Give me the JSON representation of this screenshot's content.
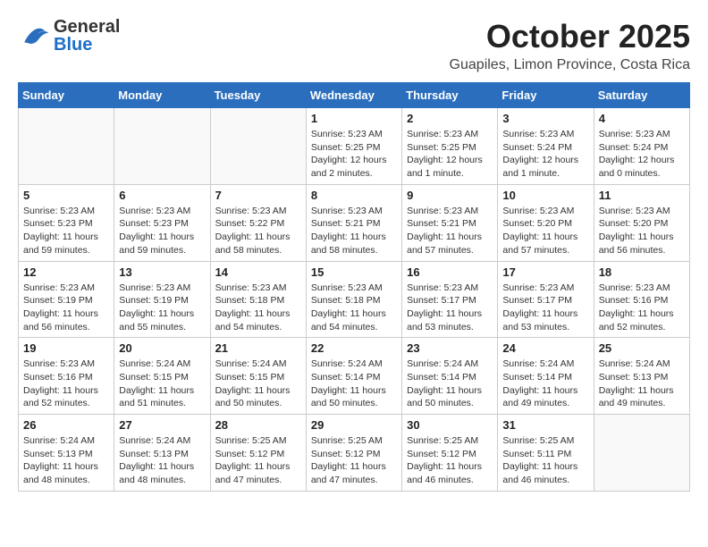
{
  "header": {
    "logo_general": "General",
    "logo_blue": "Blue",
    "month": "October 2025",
    "location": "Guapiles, Limon Province, Costa Rica"
  },
  "weekdays": [
    "Sunday",
    "Monday",
    "Tuesday",
    "Wednesday",
    "Thursday",
    "Friday",
    "Saturday"
  ],
  "weeks": [
    [
      {
        "day": "",
        "info": ""
      },
      {
        "day": "",
        "info": ""
      },
      {
        "day": "",
        "info": ""
      },
      {
        "day": "1",
        "info": "Sunrise: 5:23 AM\nSunset: 5:25 PM\nDaylight: 12 hours and 2 minutes."
      },
      {
        "day": "2",
        "info": "Sunrise: 5:23 AM\nSunset: 5:25 PM\nDaylight: 12 hours and 1 minute."
      },
      {
        "day": "3",
        "info": "Sunrise: 5:23 AM\nSunset: 5:24 PM\nDaylight: 12 hours and 1 minute."
      },
      {
        "day": "4",
        "info": "Sunrise: 5:23 AM\nSunset: 5:24 PM\nDaylight: 12 hours and 0 minutes."
      }
    ],
    [
      {
        "day": "5",
        "info": "Sunrise: 5:23 AM\nSunset: 5:23 PM\nDaylight: 11 hours and 59 minutes."
      },
      {
        "day": "6",
        "info": "Sunrise: 5:23 AM\nSunset: 5:23 PM\nDaylight: 11 hours and 59 minutes."
      },
      {
        "day": "7",
        "info": "Sunrise: 5:23 AM\nSunset: 5:22 PM\nDaylight: 11 hours and 58 minutes."
      },
      {
        "day": "8",
        "info": "Sunrise: 5:23 AM\nSunset: 5:21 PM\nDaylight: 11 hours and 58 minutes."
      },
      {
        "day": "9",
        "info": "Sunrise: 5:23 AM\nSunset: 5:21 PM\nDaylight: 11 hours and 57 minutes."
      },
      {
        "day": "10",
        "info": "Sunrise: 5:23 AM\nSunset: 5:20 PM\nDaylight: 11 hours and 57 minutes."
      },
      {
        "day": "11",
        "info": "Sunrise: 5:23 AM\nSunset: 5:20 PM\nDaylight: 11 hours and 56 minutes."
      }
    ],
    [
      {
        "day": "12",
        "info": "Sunrise: 5:23 AM\nSunset: 5:19 PM\nDaylight: 11 hours and 56 minutes."
      },
      {
        "day": "13",
        "info": "Sunrise: 5:23 AM\nSunset: 5:19 PM\nDaylight: 11 hours and 55 minutes."
      },
      {
        "day": "14",
        "info": "Sunrise: 5:23 AM\nSunset: 5:18 PM\nDaylight: 11 hours and 54 minutes."
      },
      {
        "day": "15",
        "info": "Sunrise: 5:23 AM\nSunset: 5:18 PM\nDaylight: 11 hours and 54 minutes."
      },
      {
        "day": "16",
        "info": "Sunrise: 5:23 AM\nSunset: 5:17 PM\nDaylight: 11 hours and 53 minutes."
      },
      {
        "day": "17",
        "info": "Sunrise: 5:23 AM\nSunset: 5:17 PM\nDaylight: 11 hours and 53 minutes."
      },
      {
        "day": "18",
        "info": "Sunrise: 5:23 AM\nSunset: 5:16 PM\nDaylight: 11 hours and 52 minutes."
      }
    ],
    [
      {
        "day": "19",
        "info": "Sunrise: 5:23 AM\nSunset: 5:16 PM\nDaylight: 11 hours and 52 minutes."
      },
      {
        "day": "20",
        "info": "Sunrise: 5:24 AM\nSunset: 5:15 PM\nDaylight: 11 hours and 51 minutes."
      },
      {
        "day": "21",
        "info": "Sunrise: 5:24 AM\nSunset: 5:15 PM\nDaylight: 11 hours and 50 minutes."
      },
      {
        "day": "22",
        "info": "Sunrise: 5:24 AM\nSunset: 5:14 PM\nDaylight: 11 hours and 50 minutes."
      },
      {
        "day": "23",
        "info": "Sunrise: 5:24 AM\nSunset: 5:14 PM\nDaylight: 11 hours and 50 minutes."
      },
      {
        "day": "24",
        "info": "Sunrise: 5:24 AM\nSunset: 5:14 PM\nDaylight: 11 hours and 49 minutes."
      },
      {
        "day": "25",
        "info": "Sunrise: 5:24 AM\nSunset: 5:13 PM\nDaylight: 11 hours and 49 minutes."
      }
    ],
    [
      {
        "day": "26",
        "info": "Sunrise: 5:24 AM\nSunset: 5:13 PM\nDaylight: 11 hours and 48 minutes."
      },
      {
        "day": "27",
        "info": "Sunrise: 5:24 AM\nSunset: 5:13 PM\nDaylight: 11 hours and 48 minutes."
      },
      {
        "day": "28",
        "info": "Sunrise: 5:25 AM\nSunset: 5:12 PM\nDaylight: 11 hours and 47 minutes."
      },
      {
        "day": "29",
        "info": "Sunrise: 5:25 AM\nSunset: 5:12 PM\nDaylight: 11 hours and 47 minutes."
      },
      {
        "day": "30",
        "info": "Sunrise: 5:25 AM\nSunset: 5:12 PM\nDaylight: 11 hours and 46 minutes."
      },
      {
        "day": "31",
        "info": "Sunrise: 5:25 AM\nSunset: 5:11 PM\nDaylight: 11 hours and 46 minutes."
      },
      {
        "day": "",
        "info": ""
      }
    ]
  ]
}
